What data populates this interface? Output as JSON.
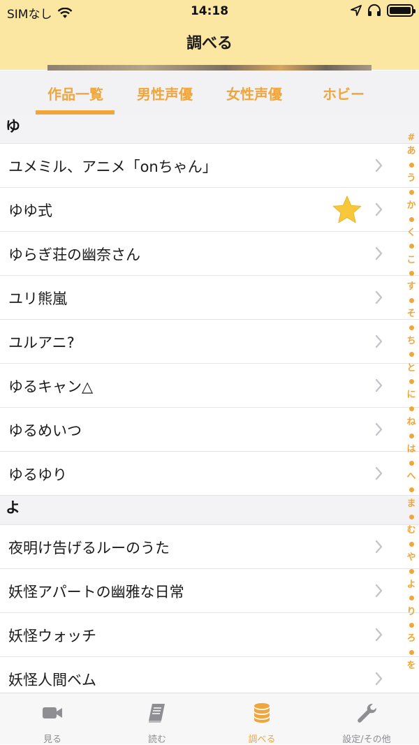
{
  "status_bar": {
    "carrier": "SIMなし",
    "time": "14:18"
  },
  "header": {
    "title": "調べる"
  },
  "tabs": [
    {
      "label": "作品一覧",
      "active": true
    },
    {
      "label": "男性声優",
      "active": false
    },
    {
      "label": "女性声優",
      "active": false
    },
    {
      "label": "ホビー",
      "active": false
    }
  ],
  "sections": [
    {
      "header": "ゆ",
      "rows": [
        {
          "label": "ユメミル、アニメ「onちゃん」",
          "favorite": false
        },
        {
          "label": "ゆゆ式",
          "favorite": true
        },
        {
          "label": "ゆらぎ荘の幽奈さん",
          "favorite": false
        },
        {
          "label": "ユリ熊嵐",
          "favorite": false
        },
        {
          "label": "ユルアニ?",
          "favorite": false
        },
        {
          "label": "ゆるキャン△",
          "favorite": false
        },
        {
          "label": "ゆるめいつ",
          "favorite": false
        },
        {
          "label": "ゆるゆり",
          "favorite": false
        }
      ]
    },
    {
      "header": "よ",
      "rows": [
        {
          "label": "夜明け告げるルーのうた",
          "favorite": false
        },
        {
          "label": "妖怪アパートの幽雅な日常",
          "favorite": false
        },
        {
          "label": "妖怪ウォッチ",
          "favorite": false
        },
        {
          "label": "妖怪人間ベム",
          "favorite": false
        }
      ]
    }
  ],
  "index_bar": [
    "#",
    "あ",
    "•",
    "う",
    "•",
    "か",
    "•",
    "く",
    "•",
    "こ",
    "•",
    "す",
    "•",
    "そ",
    "•",
    "ち",
    "•",
    "と",
    "•",
    "に",
    "•",
    "ね",
    "•",
    "は",
    "•",
    "へ",
    "•",
    "ま",
    "•",
    "む",
    "•",
    "や",
    "•",
    "よ",
    "•",
    "り",
    "•",
    "ろ",
    "•",
    "を"
  ],
  "tabbar": [
    {
      "label": "見る",
      "icon": "video-camera-icon",
      "active": false
    },
    {
      "label": "読む",
      "icon": "book-icon",
      "active": false
    },
    {
      "label": "調べる",
      "icon": "database-icon",
      "active": true
    },
    {
      "label": "設定/その他",
      "icon": "wrench-icon",
      "active": false
    }
  ],
  "colors": {
    "accent": "#f0a63a",
    "header_bg": "#fbe7a1",
    "star": "#f8c83c",
    "inactive": "#8e8e93"
  }
}
